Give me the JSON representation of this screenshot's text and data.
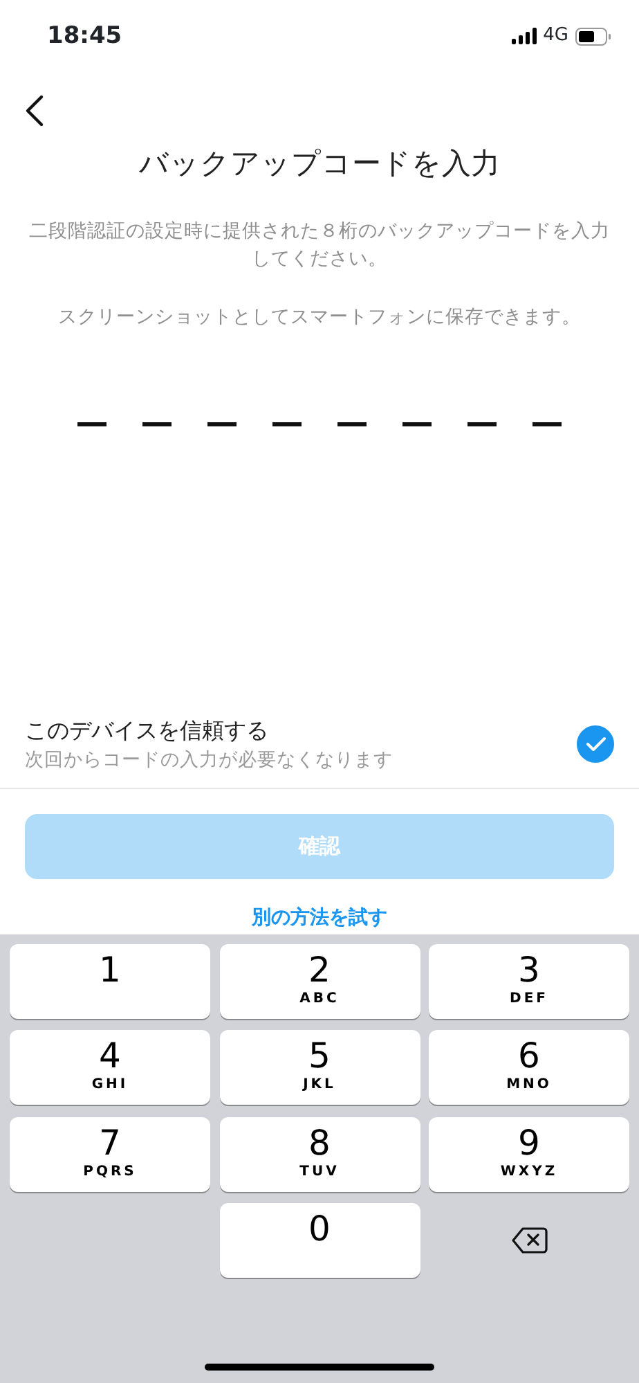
{
  "status_bar": {
    "time": "18:45",
    "network": "4G"
  },
  "header": {
    "title": "バックアップコードを入力"
  },
  "description": "二段階認証の設定時に提供された８桁のバックアップコードを入力してください。",
  "note": "スクリーンショットとしてスマートフォンに保存できます。",
  "code_slots": [
    {
      "kind": "empty"
    },
    {
      "kind": "empty"
    },
    {
      "kind": "empty"
    },
    {
      "kind": "empty"
    },
    {
      "kind": "empty"
    },
    {
      "kind": "empty"
    },
    {
      "kind": "empty"
    },
    {
      "kind": "empty"
    }
  ],
  "trust_device": {
    "label": "このデバイスを信頼する",
    "sublabel": "次回からコードの入力が必要なくなります",
    "checked": true
  },
  "confirm_button": {
    "label": "確認",
    "disabled": true
  },
  "alt_link": "別の方法を試す",
  "keypad": [
    {
      "kind": "digit",
      "digit": "1"
    },
    {
      "kind": "digit",
      "digit": "2",
      "letters": "ABC"
    },
    {
      "kind": "digit",
      "digit": "3",
      "letters": "DEF"
    },
    {
      "kind": "digit",
      "digit": "4",
      "letters": "GHI"
    },
    {
      "kind": "digit",
      "digit": "5",
      "letters": "JKL"
    },
    {
      "kind": "digit",
      "digit": "6",
      "letters": "MNO"
    },
    {
      "kind": "digit",
      "digit": "7",
      "letters": "PQRS"
    },
    {
      "kind": "digit",
      "digit": "8",
      "letters": "TUV"
    },
    {
      "kind": "digit",
      "digit": "9",
      "letters": "WXYZ"
    },
    {
      "kind": "blank"
    },
    {
      "kind": "digit",
      "digit": "0"
    },
    {
      "kind": "delete"
    }
  ]
}
